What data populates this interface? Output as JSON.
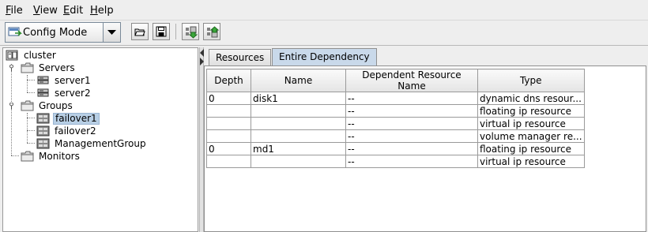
{
  "menu": {
    "file": {
      "mnemonic": "F",
      "rest": "ile"
    },
    "view": {
      "mnemonic": "V",
      "rest": "iew"
    },
    "edit": {
      "mnemonic": "E",
      "rest": "dit"
    },
    "help": {
      "mnemonic": "H",
      "rest": "elp"
    }
  },
  "toolbar": {
    "mode_value": "Config Mode",
    "icons": [
      "open-folder-icon",
      "save-disk-icon",
      "download-arrow-icon",
      "upload-arrow-icon"
    ]
  },
  "tree": {
    "root": "cluster",
    "servers": {
      "label": "Servers",
      "items": [
        "server1",
        "server2"
      ]
    },
    "groups": {
      "label": "Groups",
      "items": [
        "failover1",
        "failover2",
        "ManagementGroup"
      ],
      "selected": "failover1"
    },
    "monitors": {
      "label": "Monitors"
    }
  },
  "tabs": [
    {
      "label": "Resources",
      "active": false
    },
    {
      "label": "Entire Dependency",
      "active": true
    }
  ],
  "table": {
    "columns": [
      "Depth",
      "Name",
      "Dependent Resource Name",
      "Type"
    ],
    "rows": [
      [
        "0",
        "disk1",
        "--",
        "dynamic dns resour..."
      ],
      [
        "",
        "",
        "--",
        "floating ip resource"
      ],
      [
        "",
        "",
        "--",
        "virtual ip resource"
      ],
      [
        "",
        "",
        "--",
        "volume manager re..."
      ],
      [
        "0",
        "md1",
        "--",
        "floating ip resource"
      ],
      [
        "",
        "",
        "--",
        "virtual ip resource"
      ]
    ]
  },
  "colors": {
    "selection": "#b8cfe5",
    "active_tab": "#c9d9ea",
    "folder": "#e8c36a"
  }
}
